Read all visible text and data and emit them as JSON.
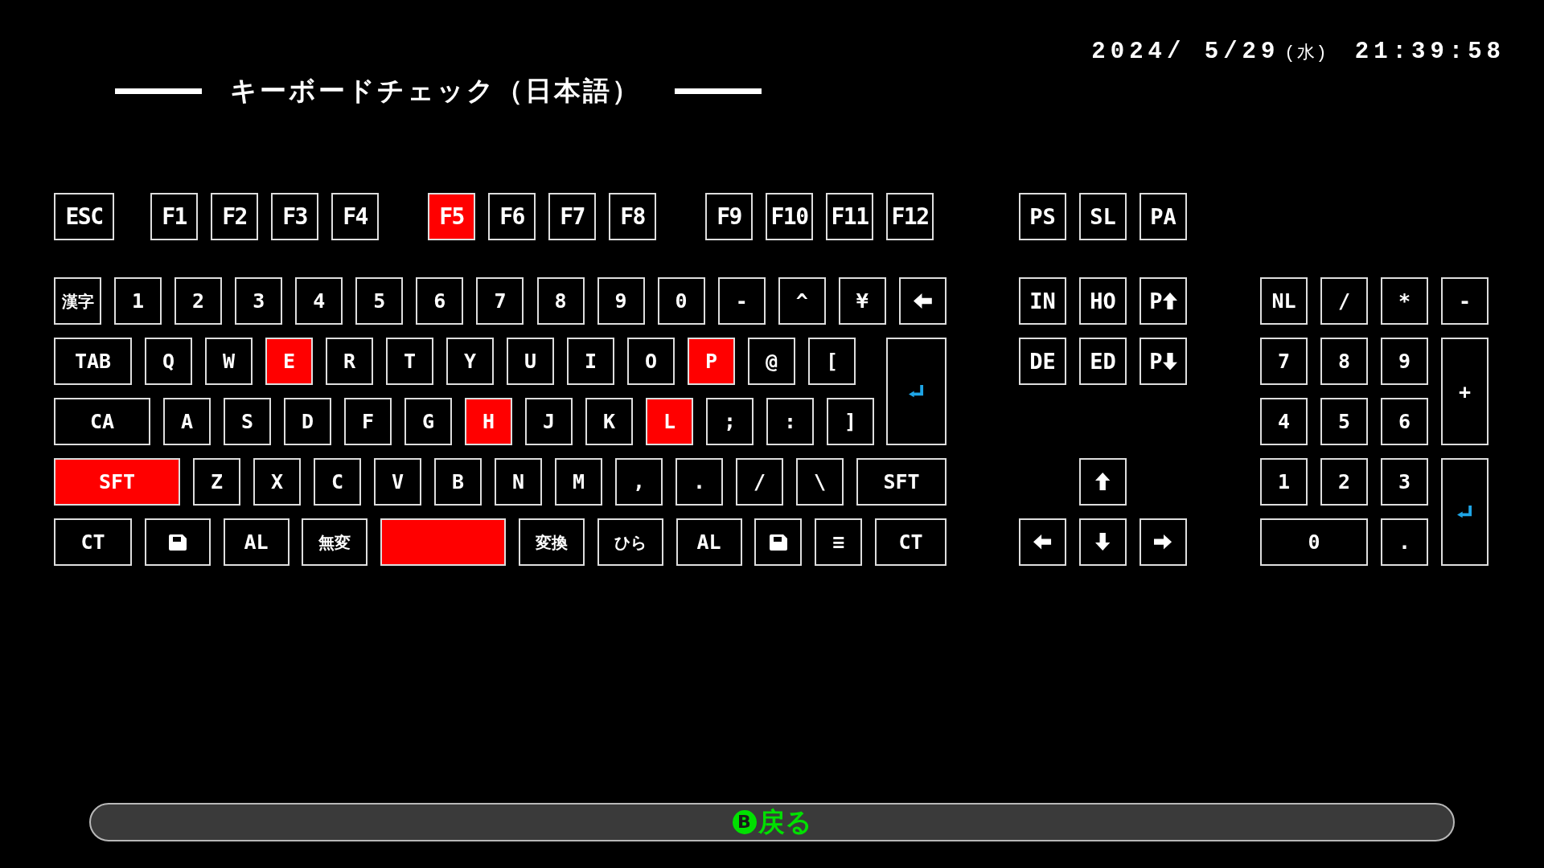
{
  "header": {
    "date": "2024/ 5/29",
    "weekday": "(水)",
    "time": "21:39:58",
    "title": "キーボードチェック（日本語）"
  },
  "function_row": [
    [
      {
        "kind": "label",
        "label": "ESC",
        "pressed": false
      }
    ],
    [
      {
        "kind": "label",
        "label": "F1",
        "pressed": false
      },
      {
        "kind": "label",
        "label": "F2",
        "pressed": false
      },
      {
        "kind": "label",
        "label": "F3",
        "pressed": false
      },
      {
        "kind": "label",
        "label": "F4",
        "pressed": false
      }
    ],
    [
      {
        "kind": "label",
        "label": "F5",
        "pressed": true
      },
      {
        "kind": "label",
        "label": "F6",
        "pressed": false
      },
      {
        "kind": "label",
        "label": "F7",
        "pressed": false
      },
      {
        "kind": "label",
        "label": "F8",
        "pressed": false
      }
    ],
    [
      {
        "kind": "label",
        "label": "F9",
        "pressed": false
      },
      {
        "kind": "label",
        "label": "F10",
        "pressed": false
      },
      {
        "kind": "label",
        "label": "F11",
        "pressed": false
      },
      {
        "kind": "label",
        "label": "F12",
        "pressed": false
      }
    ]
  ],
  "system_keys": [
    {
      "kind": "label",
      "label": "PS",
      "pressed": false
    },
    {
      "kind": "label",
      "label": "SL",
      "pressed": false
    },
    {
      "kind": "label",
      "label": "PA",
      "pressed": false
    }
  ],
  "main_rows": [
    [
      {
        "kind": "cjk",
        "label": "漢字",
        "pressed": false
      },
      {
        "kind": "label",
        "label": "1",
        "pressed": false
      },
      {
        "kind": "label",
        "label": "2",
        "pressed": false
      },
      {
        "kind": "label",
        "label": "3",
        "pressed": false
      },
      {
        "kind": "label",
        "label": "4",
        "pressed": false
      },
      {
        "kind": "label",
        "label": "5",
        "pressed": false
      },
      {
        "kind": "label",
        "label": "6",
        "pressed": false
      },
      {
        "kind": "label",
        "label": "7",
        "pressed": false
      },
      {
        "kind": "label",
        "label": "8",
        "pressed": false
      },
      {
        "kind": "label",
        "label": "9",
        "pressed": false
      },
      {
        "kind": "label",
        "label": "0",
        "pressed": false
      },
      {
        "kind": "label",
        "label": "-",
        "pressed": false
      },
      {
        "kind": "label",
        "label": "^",
        "pressed": false
      },
      {
        "kind": "label",
        "label": "¥",
        "pressed": false
      },
      {
        "kind": "backspace",
        "pressed": false
      }
    ],
    [
      {
        "kind": "label",
        "label": "TAB",
        "pressed": false
      },
      {
        "kind": "label",
        "label": "Q",
        "pressed": false
      },
      {
        "kind": "label",
        "label": "W",
        "pressed": false
      },
      {
        "kind": "label",
        "label": "E",
        "pressed": true
      },
      {
        "kind": "label",
        "label": "R",
        "pressed": false
      },
      {
        "kind": "label",
        "label": "T",
        "pressed": false
      },
      {
        "kind": "label",
        "label": "Y",
        "pressed": false
      },
      {
        "kind": "label",
        "label": "U",
        "pressed": false
      },
      {
        "kind": "label",
        "label": "I",
        "pressed": false
      },
      {
        "kind": "label",
        "label": "O",
        "pressed": false
      },
      {
        "kind": "label",
        "label": "P",
        "pressed": true
      },
      {
        "kind": "label",
        "label": "@",
        "pressed": false
      },
      {
        "kind": "label",
        "label": "[",
        "pressed": false
      },
      {
        "kind": "enter",
        "pressed": false
      }
    ],
    [
      {
        "kind": "label",
        "label": "CA",
        "pressed": false
      },
      {
        "kind": "label",
        "label": "A",
        "pressed": false
      },
      {
        "kind": "label",
        "label": "S",
        "pressed": false
      },
      {
        "kind": "label",
        "label": "D",
        "pressed": false
      },
      {
        "kind": "label",
        "label": "F",
        "pressed": false
      },
      {
        "kind": "label",
        "label": "G",
        "pressed": false
      },
      {
        "kind": "label",
        "label": "H",
        "pressed": true
      },
      {
        "kind": "label",
        "label": "J",
        "pressed": false
      },
      {
        "kind": "label",
        "label": "K",
        "pressed": false
      },
      {
        "kind": "label",
        "label": "L",
        "pressed": true
      },
      {
        "kind": "label",
        "label": ";",
        "pressed": false
      },
      {
        "kind": "label",
        "label": ":",
        "pressed": false
      },
      {
        "kind": "label",
        "label": "]",
        "pressed": false
      }
    ],
    [
      {
        "kind": "label",
        "label": "SFT",
        "pressed": true
      },
      {
        "kind": "label",
        "label": "Z",
        "pressed": false
      },
      {
        "kind": "label",
        "label": "X",
        "pressed": false
      },
      {
        "kind": "label",
        "label": "C",
        "pressed": false
      },
      {
        "kind": "label",
        "label": "V",
        "pressed": false
      },
      {
        "kind": "label",
        "label": "B",
        "pressed": false
      },
      {
        "kind": "label",
        "label": "N",
        "pressed": false
      },
      {
        "kind": "label",
        "label": "M",
        "pressed": false
      },
      {
        "kind": "label",
        "label": ",",
        "pressed": false
      },
      {
        "kind": "label",
        "label": ".",
        "pressed": false
      },
      {
        "kind": "label",
        "label": "/",
        "pressed": false
      },
      {
        "kind": "label",
        "label": "\\",
        "pressed": false
      },
      {
        "kind": "label",
        "label": "SFT",
        "pressed": false
      }
    ],
    [
      {
        "kind": "label",
        "label": "CT",
        "pressed": false
      },
      {
        "kind": "windows",
        "pressed": false
      },
      {
        "kind": "label",
        "label": "AL",
        "pressed": false
      },
      {
        "kind": "cjk",
        "label": "無変",
        "pressed": false
      },
      {
        "kind": "space",
        "pressed": true
      },
      {
        "kind": "cjk",
        "label": "変換",
        "pressed": false
      },
      {
        "kind": "cjk",
        "label": "ひら",
        "pressed": false
      },
      {
        "kind": "label",
        "label": "AL",
        "pressed": false
      },
      {
        "kind": "windows",
        "pressed": false
      },
      {
        "kind": "label",
        "label": "≡",
        "pressed": false
      },
      {
        "kind": "label",
        "label": "CT",
        "pressed": false
      }
    ]
  ],
  "nav_rows": [
    [
      {
        "kind": "label",
        "label": "IN",
        "pressed": false
      },
      {
        "kind": "label",
        "label": "HO",
        "pressed": false
      },
      {
        "kind": "page_up",
        "label": "P",
        "pressed": false
      }
    ],
    [
      {
        "kind": "label",
        "label": "DE",
        "pressed": false
      },
      {
        "kind": "label",
        "label": "ED",
        "pressed": false
      },
      {
        "kind": "page_down",
        "label": "P",
        "pressed": false
      }
    ],
    [
      {
        "kind": "up",
        "pressed": false
      }
    ],
    [
      {
        "kind": "left",
        "pressed": false
      },
      {
        "kind": "down",
        "pressed": false
      },
      {
        "kind": "right",
        "pressed": false
      }
    ]
  ],
  "numpad_rows": [
    [
      {
        "kind": "label",
        "label": "NL",
        "pressed": false
      },
      {
        "kind": "label",
        "label": "/",
        "pressed": false
      },
      {
        "kind": "label",
        "label": "*",
        "pressed": false
      },
      {
        "kind": "label",
        "label": "-",
        "pressed": false
      }
    ],
    [
      {
        "kind": "label",
        "label": "7",
        "pressed": false
      },
      {
        "kind": "label",
        "label": "8",
        "pressed": false
      },
      {
        "kind": "label",
        "label": "9",
        "pressed": false
      },
      {
        "kind": "label",
        "label": "+",
        "pressed": false
      }
    ],
    [
      {
        "kind": "label",
        "label": "4",
        "pressed": false
      },
      {
        "kind": "label",
        "label": "5",
        "pressed": false
      },
      {
        "kind": "label",
        "label": "6",
        "pressed": false
      }
    ],
    [
      {
        "kind": "label",
        "label": "1",
        "pressed": false
      },
      {
        "kind": "label",
        "label": "2",
        "pressed": false
      },
      {
        "kind": "label",
        "label": "3",
        "pressed": false
      },
      {
        "kind": "enter",
        "pressed": false
      }
    ],
    [
      {
        "kind": "label",
        "label": "0",
        "pressed": false
      },
      {
        "kind": "label",
        "label": ".",
        "pressed": false
      }
    ]
  ],
  "footer": {
    "button": "B",
    "label": "戻る"
  }
}
